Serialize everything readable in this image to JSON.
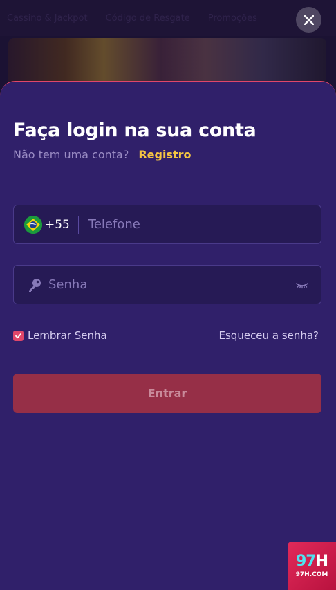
{
  "background": {
    "nav_items": [
      "Cassino & Jackpot",
      "Código de Resgate",
      "Promoções"
    ]
  },
  "modal": {
    "title": "Faça login na sua conta",
    "no_account_text": "Não tem uma conta?",
    "register_link": "Registro",
    "phone": {
      "country_code": "+55",
      "flag_icon": "brazil-flag-icon",
      "placeholder": "Telefone",
      "value": ""
    },
    "password": {
      "placeholder": "Senha",
      "value": "",
      "left_icon": "key-icon",
      "toggle_icon": "eye-closed-icon"
    },
    "remember": {
      "label": "Lembrar Senha",
      "checked": true
    },
    "forgot_link": "Esqueceu a senha?",
    "submit_label": "Entrar"
  },
  "badge": {
    "number": "97",
    "letter": "H",
    "domain": "97H.COM"
  },
  "colors": {
    "sheet_bg": "#30206a",
    "accent": "#e0466a",
    "link_yellow": "#f5c542",
    "submit_bg": "#962f47"
  }
}
